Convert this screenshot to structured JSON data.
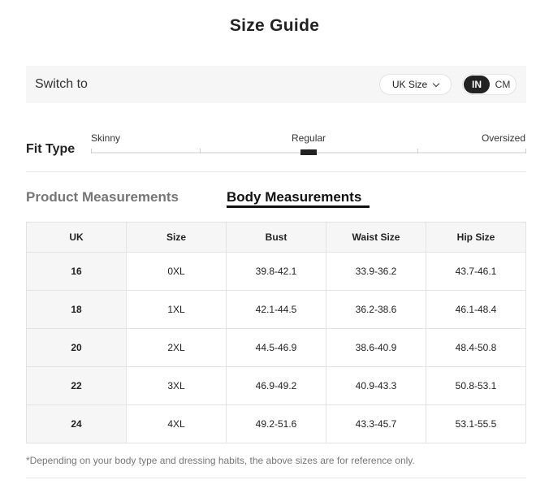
{
  "title": "Size Guide",
  "switch": {
    "label": "Switch to",
    "size_select": "UK Size",
    "units": {
      "in": "IN",
      "cm": "CM",
      "selected": "IN"
    }
  },
  "fit": {
    "label": "Fit Type",
    "options": [
      "Skinny",
      "Regular",
      "Oversized"
    ],
    "selected": "Regular"
  },
  "tabs": {
    "product": "Product Measurements",
    "body": "Body Measurements",
    "active": "body"
  },
  "table": {
    "headers": [
      "UK",
      "Size",
      "Bust",
      "Waist Size",
      "Hip Size"
    ],
    "rows": [
      [
        "16",
        "0XL",
        "39.8-42.1",
        "33.9-36.2",
        "43.7-46.1"
      ],
      [
        "18",
        "1XL",
        "42.1-44.5",
        "36.2-38.6",
        "46.1-48.4"
      ],
      [
        "20",
        "2XL",
        "44.5-46.9",
        "38.6-40.9",
        "48.4-50.8"
      ],
      [
        "22",
        "3XL",
        "46.9-49.2",
        "40.9-43.3",
        "50.8-53.1"
      ],
      [
        "24",
        "4XL",
        "49.2-51.6",
        "43.3-45.7",
        "53.1-55.5"
      ]
    ]
  },
  "note": "*Depending on your body type and dressing habits, the above sizes are for reference only."
}
